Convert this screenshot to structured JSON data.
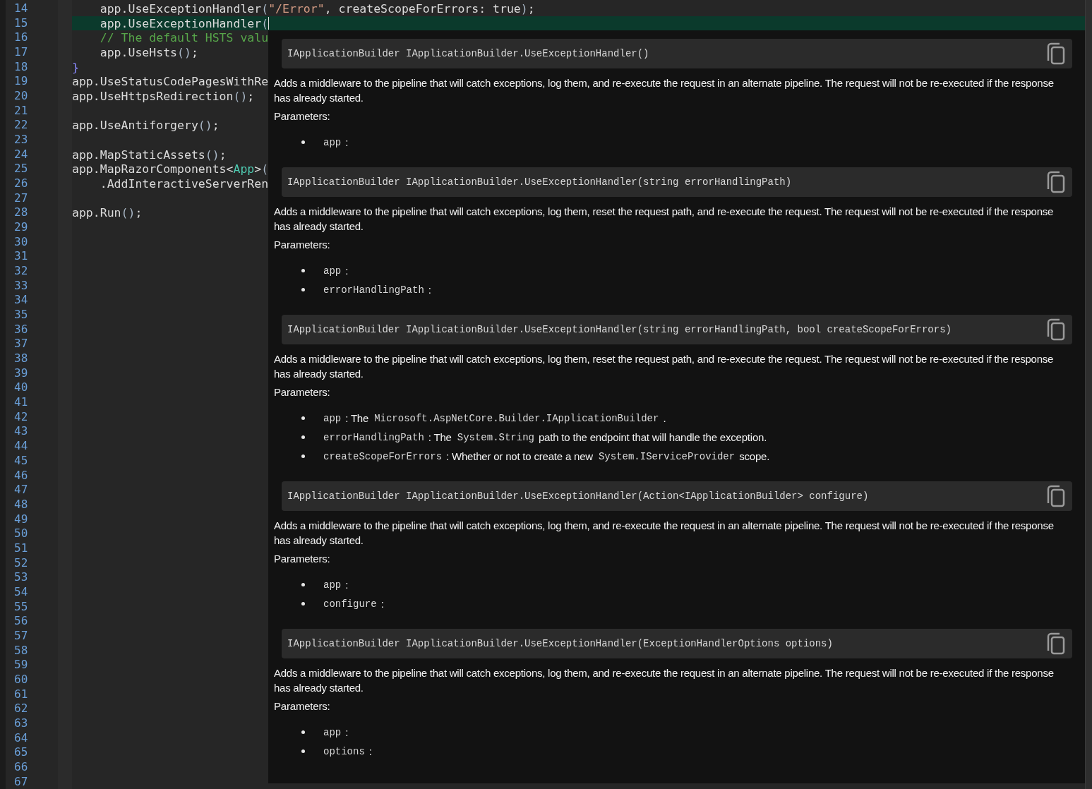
{
  "editor": {
    "lines": [
      {
        "number": "14",
        "current": false,
        "tokens": [
          {
            "text": "    app.UseExceptionHandler",
            "kind": "plain"
          },
          {
            "text": "(",
            "kind": "punct"
          },
          {
            "text": "\"/Error\"",
            "kind": "string"
          },
          {
            "text": ", createScopeForErrors: true",
            "kind": "plain"
          },
          {
            "text": ")",
            "kind": "punct"
          },
          {
            "text": ";",
            "kind": "plain"
          }
        ]
      },
      {
        "number": "15",
        "current": true,
        "tokens": [
          {
            "text": "    app.UseExceptionHandler",
            "kind": "plain"
          },
          {
            "text": "(",
            "kind": "punct"
          }
        ]
      },
      {
        "number": "16",
        "current": false,
        "tokens": [
          {
            "text": "    // The default HSTS valu",
            "kind": "comment"
          }
        ]
      },
      {
        "number": "17",
        "current": false,
        "tokens": [
          {
            "text": "    app.UseHsts",
            "kind": "plain"
          },
          {
            "text": "()",
            "kind": "punct"
          },
          {
            "text": ";",
            "kind": "plain"
          }
        ]
      },
      {
        "number": "18",
        "current": false,
        "tokens": [
          {
            "text": "}",
            "kind": "brace"
          }
        ]
      },
      {
        "number": "19",
        "current": false,
        "tokens": [
          {
            "text": "app.UseStatusCodePagesWithRe",
            "kind": "plain"
          }
        ]
      },
      {
        "number": "20",
        "current": false,
        "tokens": [
          {
            "text": "app.UseHttpsRedirection",
            "kind": "plain"
          },
          {
            "text": "()",
            "kind": "punct"
          },
          {
            "text": ";",
            "kind": "plain"
          }
        ]
      },
      {
        "number": "21",
        "current": false
      },
      {
        "number": "22",
        "current": false,
        "tokens": [
          {
            "text": "app.UseAntiforgery",
            "kind": "plain"
          },
          {
            "text": "()",
            "kind": "punct"
          },
          {
            "text": ";",
            "kind": "plain"
          }
        ]
      },
      {
        "number": "23",
        "current": false
      },
      {
        "number": "24",
        "current": false,
        "tokens": [
          {
            "text": "app.MapStaticAssets",
            "kind": "plain"
          },
          {
            "text": "()",
            "kind": "punct"
          },
          {
            "text": ";",
            "kind": "plain"
          }
        ]
      },
      {
        "number": "25",
        "current": false,
        "tokens": [
          {
            "text": "app.MapRazorComponents<",
            "kind": "plain"
          },
          {
            "text": "App",
            "kind": "type"
          },
          {
            "text": ">",
            "kind": "plain"
          },
          {
            "text": "(",
            "kind": "punct"
          }
        ]
      },
      {
        "number": "26",
        "current": false,
        "tokens": [
          {
            "text": "    .AddInteractiveServerRen",
            "kind": "plain"
          }
        ]
      },
      {
        "number": "27",
        "current": false
      },
      {
        "number": "28",
        "current": false,
        "tokens": [
          {
            "text": "app.Run",
            "kind": "plain"
          },
          {
            "text": "()",
            "kind": "punct"
          },
          {
            "text": ";",
            "kind": "plain"
          }
        ]
      },
      {
        "number": "29",
        "current": false
      },
      {
        "number": "30",
        "current": false
      },
      {
        "number": "31",
        "current": false
      },
      {
        "number": "32",
        "current": false
      },
      {
        "number": "33",
        "current": false
      },
      {
        "number": "34",
        "current": false
      },
      {
        "number": "35",
        "current": false
      },
      {
        "number": "36",
        "current": false
      },
      {
        "number": "37",
        "current": false
      },
      {
        "number": "38",
        "current": false
      },
      {
        "number": "39",
        "current": false
      },
      {
        "number": "40",
        "current": false
      },
      {
        "number": "41",
        "current": false
      },
      {
        "number": "42",
        "current": false
      },
      {
        "number": "43",
        "current": false
      },
      {
        "number": "44",
        "current": false
      },
      {
        "number": "45",
        "current": false
      },
      {
        "number": "46",
        "current": false
      },
      {
        "number": "47",
        "current": false
      },
      {
        "number": "48",
        "current": false
      },
      {
        "number": "49",
        "current": false
      },
      {
        "number": "50",
        "current": false
      },
      {
        "number": "51",
        "current": false
      },
      {
        "number": "52",
        "current": false
      },
      {
        "number": "53",
        "current": false
      },
      {
        "number": "54",
        "current": false
      },
      {
        "number": "55",
        "current": false
      },
      {
        "number": "56",
        "current": false
      },
      {
        "number": "57",
        "current": false
      },
      {
        "number": "58",
        "current": false
      },
      {
        "number": "59",
        "current": false
      },
      {
        "number": "60",
        "current": false
      },
      {
        "number": "61",
        "current": false
      },
      {
        "number": "62",
        "current": false
      },
      {
        "number": "63",
        "current": false
      },
      {
        "number": "64",
        "current": false
      },
      {
        "number": "65",
        "current": false
      },
      {
        "number": "66",
        "current": false
      },
      {
        "number": "67",
        "current": false
      }
    ]
  },
  "hover_popup": {
    "entries": [
      {
        "signature": "IApplicationBuilder IApplicationBuilder.UseExceptionHandler()",
        "description": "Adds a middleware to the pipeline that will catch exceptions, log them, and re-execute the request in an alternate pipeline. The request will not be re-executed if the response has already started.",
        "parameters_label": "Parameters:",
        "parameters": [
          {
            "parts": [
              {
                "text": "app",
                "kind": "code"
              },
              {
                "text": ":",
                "kind": "text"
              }
            ]
          }
        ]
      },
      {
        "signature": "IApplicationBuilder IApplicationBuilder.UseExceptionHandler(string errorHandlingPath)",
        "description": "Adds a middleware to the pipeline that will catch exceptions, log them, reset the request path, and re-execute the request. The request will not be re-executed if the response has already started.",
        "parameters_label": "Parameters:",
        "parameters": [
          {
            "parts": [
              {
                "text": "app",
                "kind": "code"
              },
              {
                "text": ":",
                "kind": "text"
              }
            ]
          },
          {
            "parts": [
              {
                "text": "errorHandlingPath",
                "kind": "code"
              },
              {
                "text": ":",
                "kind": "text"
              }
            ]
          }
        ]
      },
      {
        "signature": "IApplicationBuilder IApplicationBuilder.UseExceptionHandler(string errorHandlingPath, bool createScopeForErrors)",
        "description": "Adds a middleware to the pipeline that will catch exceptions, log them, reset the request path, and re-execute the request. The request will not be re-executed if the response has already started.",
        "parameters_label": "Parameters:",
        "parameters": [
          {
            "parts": [
              {
                "text": "app",
                "kind": "code"
              },
              {
                "text": ": The",
                "kind": "text"
              },
              {
                "text": "Microsoft.AspNetCore.Builder.IApplicationBuilder",
                "kind": "code"
              },
              {
                "text": ".",
                "kind": "text"
              }
            ]
          },
          {
            "parts": [
              {
                "text": "errorHandlingPath",
                "kind": "code"
              },
              {
                "text": ": The",
                "kind": "text"
              },
              {
                "text": "System.String",
                "kind": "code"
              },
              {
                "text": "path to the endpoint that will handle the exception.",
                "kind": "text"
              }
            ]
          },
          {
            "parts": [
              {
                "text": "createScopeForErrors",
                "kind": "code"
              },
              {
                "text": ": Whether or not to create a new",
                "kind": "text"
              },
              {
                "text": "System.IServiceProvider",
                "kind": "code"
              },
              {
                "text": "scope.",
                "kind": "text"
              }
            ]
          }
        ]
      },
      {
        "signature": "IApplicationBuilder IApplicationBuilder.UseExceptionHandler(Action<IApplicationBuilder> configure)",
        "description": "Adds a middleware to the pipeline that will catch exceptions, log them, and re-execute the request in an alternate pipeline. The request will not be re-executed if the response has already started.",
        "parameters_label": "Parameters:",
        "parameters": [
          {
            "parts": [
              {
                "text": "app",
                "kind": "code"
              },
              {
                "text": ":",
                "kind": "text"
              }
            ]
          },
          {
            "parts": [
              {
                "text": "configure",
                "kind": "code"
              },
              {
                "text": ":",
                "kind": "text"
              }
            ]
          }
        ]
      },
      {
        "signature": "IApplicationBuilder IApplicationBuilder.UseExceptionHandler(ExceptionHandlerOptions options)",
        "description": "Adds a middleware to the pipeline that will catch exceptions, log them, and re-execute the request in an alternate pipeline. The request will not be re-executed if the response has already started.",
        "parameters_label": "Parameters:",
        "parameters": [
          {
            "parts": [
              {
                "text": "app",
                "kind": "code"
              },
              {
                "text": ":",
                "kind": "text"
              }
            ]
          },
          {
            "parts": [
              {
                "text": "options",
                "kind": "code"
              },
              {
                "text": ":",
                "kind": "text"
              }
            ]
          }
        ]
      }
    ]
  }
}
